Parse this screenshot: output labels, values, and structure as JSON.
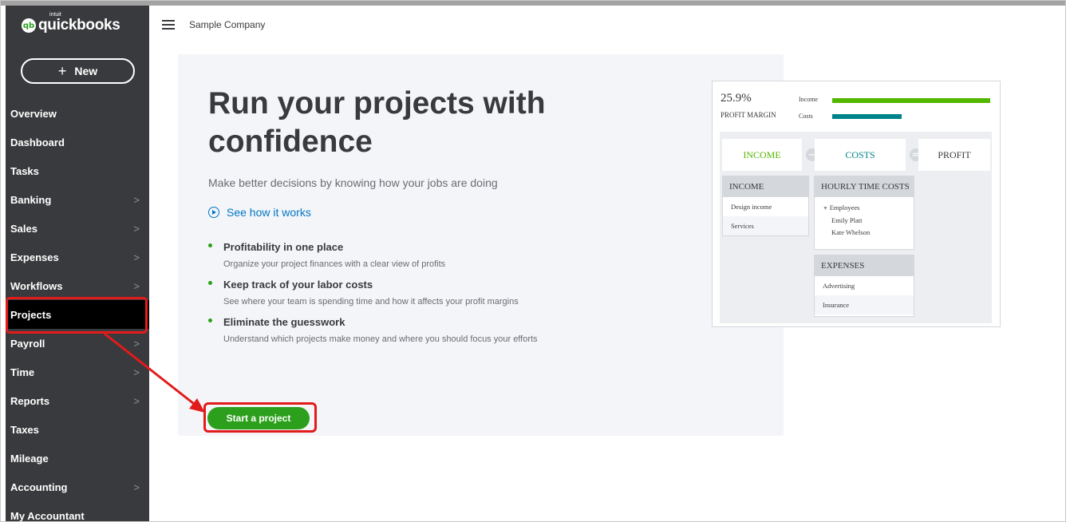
{
  "app": {
    "logo_prefix": "intuit",
    "logo_text": "quickbooks",
    "logo_mark": "qb",
    "company_name": "Sample Company"
  },
  "sidebar": {
    "new_label": "New",
    "items": [
      {
        "label": "Overview",
        "chevron": false
      },
      {
        "label": "Dashboard",
        "chevron": false
      },
      {
        "label": "Tasks",
        "chevron": false
      },
      {
        "label": "Banking",
        "chevron": true
      },
      {
        "label": "Sales",
        "chevron": true
      },
      {
        "label": "Expenses",
        "chevron": true
      },
      {
        "label": "Workflows",
        "chevron": true
      },
      {
        "label": "Projects",
        "chevron": false,
        "active": true
      },
      {
        "label": "Payroll",
        "chevron": true
      },
      {
        "label": "Time",
        "chevron": true
      },
      {
        "label": "Reports",
        "chevron": true
      },
      {
        "label": "Taxes",
        "chevron": false
      },
      {
        "label": "Mileage",
        "chevron": false
      },
      {
        "label": "Accounting",
        "chevron": true
      },
      {
        "label": "My Accountant",
        "chevron": false
      }
    ]
  },
  "main": {
    "title": "Run your projects with confidence",
    "subtitle": "Make better decisions by knowing how your jobs are doing",
    "how_link": "See how it works",
    "benefits": [
      {
        "title": "Profitability in one place",
        "desc": "Organize your project finances with a clear view of profits"
      },
      {
        "title": "Keep track of your labor costs",
        "desc": "See where your team is spending time and how it affects your profit margins"
      },
      {
        "title": "Eliminate the guesswork",
        "desc": "Understand which projects make money and where you should focus your efforts"
      }
    ],
    "cta": "Start a project"
  },
  "illustration": {
    "profit_margin_value": "25.9%",
    "profit_margin_label": "PROFIT MARGIN",
    "legend_income": "Income",
    "legend_costs": "Costs",
    "income_bar_fraction": 1.0,
    "costs_bar_fraction": 0.44,
    "eq_income": "INCOME",
    "eq_costs": "COSTS",
    "eq_profit": "PROFIT",
    "op_minus": "−",
    "op_equals": "=",
    "income_table": {
      "header": "INCOME",
      "rows": [
        "Design income",
        "Services"
      ]
    },
    "hourly_table": {
      "header": "HOURLY TIME COSTS",
      "group": "Employees",
      "rows": [
        "Emily Platt",
        "Kate Whelson"
      ]
    },
    "expenses_table": {
      "header": "EXPENSES",
      "rows": [
        "Advertising",
        "Insurance"
      ]
    }
  },
  "colors": {
    "brand_green": "#2ca01c",
    "sidebar_bg": "#393a3d",
    "link_blue": "#0077c5",
    "annotation_red": "#e21b1b",
    "income_bar": "#53b700",
    "costs_bar": "#00838a",
    "income_text": "#53b700",
    "costs_text": "#00838a"
  }
}
